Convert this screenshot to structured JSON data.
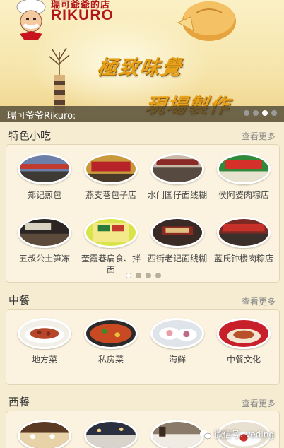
{
  "banner": {
    "brand_cn": "瑞可爺爺的店",
    "brand_en": "RIKURO",
    "slogan1": "極致味覺",
    "slogan2": "現場製作",
    "caption": "瑞可爷爷Rikuro:",
    "active_slide": 3,
    "slide_count": 4
  },
  "sections": [
    {
      "title": "特色小吃",
      "more": "查看更多",
      "items": [
        {
          "label": "郑记煎包",
          "icon": "shop-photo"
        },
        {
          "label": "燕支巷包子店",
          "icon": "shop-photo"
        },
        {
          "label": "水门国仔面线糊",
          "icon": "shop-photo"
        },
        {
          "label": "侯阿婆肉粽店",
          "icon": "shop-photo"
        },
        {
          "label": "五叔公土笋冻",
          "icon": "shop-photo"
        },
        {
          "label": "奎霞巷扁食、拌面",
          "icon": "shop-photo"
        },
        {
          "label": "西街老记面线糊",
          "icon": "shop-photo"
        },
        {
          "label": "蓝氏钟楼肉粽店",
          "icon": "shop-photo"
        }
      ],
      "active_page": 1,
      "page_count": 4
    },
    {
      "title": "中餐",
      "more": "查看更多",
      "items": [
        {
          "label": "地方菜",
          "icon": "dish-photo"
        },
        {
          "label": "私房菜",
          "icon": "dish-photo"
        },
        {
          "label": "海鲜",
          "icon": "dish-photo"
        },
        {
          "label": "中餐文化",
          "icon": "dish-photo"
        }
      ]
    },
    {
      "title": "西餐",
      "more": "查看更多",
      "items": []
    }
  ],
  "watermark": "微信号: veding",
  "colors": {
    "accent_red": "#b3171e",
    "slogan_gold": "#e8a21a",
    "page_bg": "#f6ecd2"
  }
}
